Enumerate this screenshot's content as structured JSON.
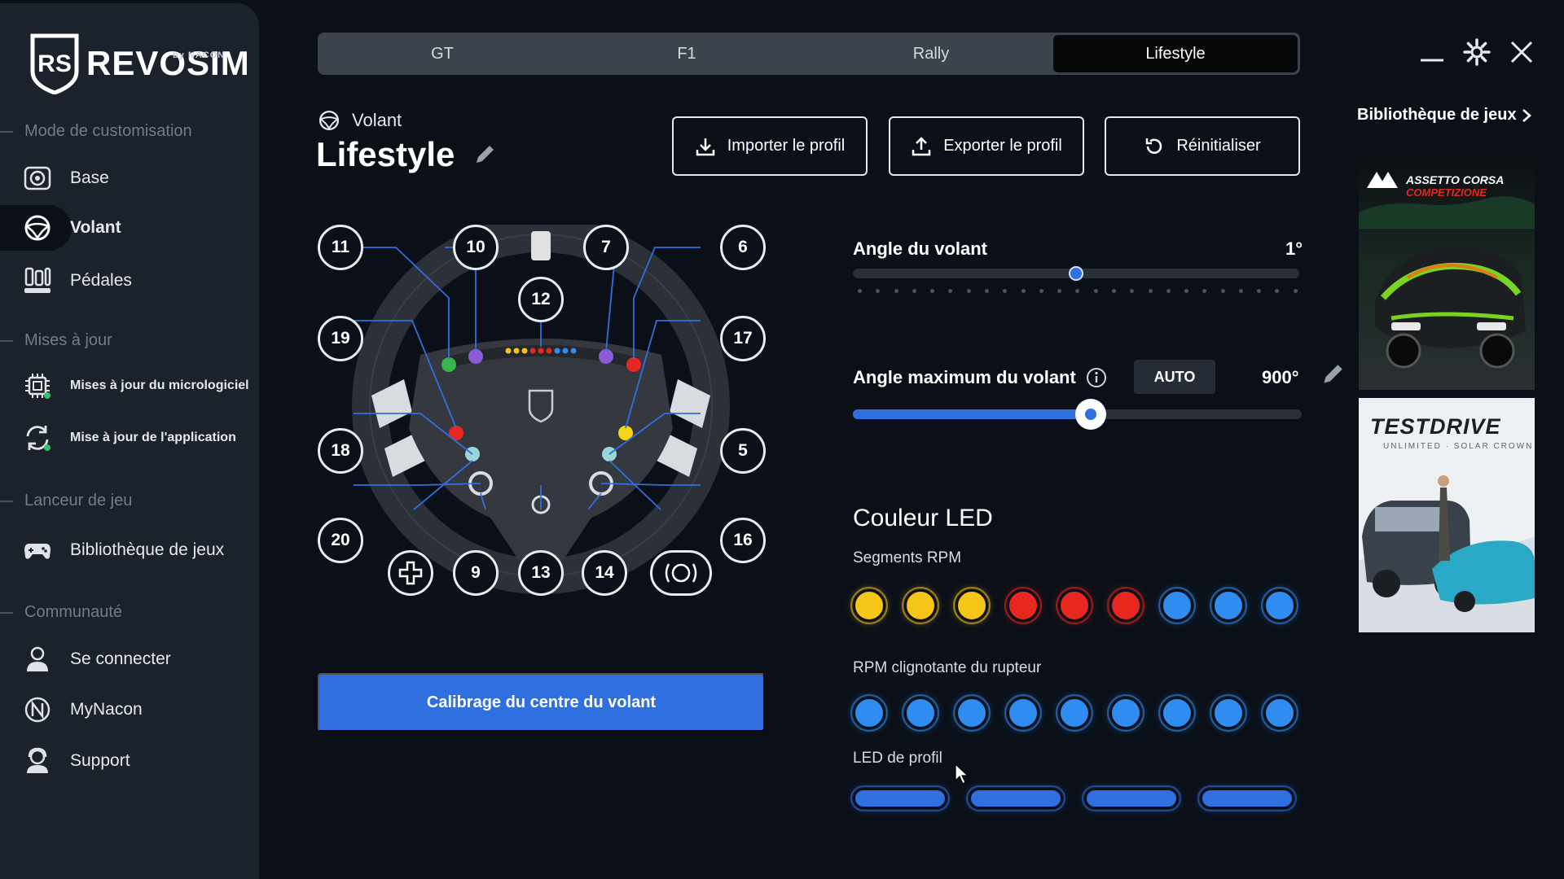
{
  "app": {
    "brand": "REVOSIM",
    "brand_sub": "by NACON"
  },
  "sidebar": {
    "sections": [
      {
        "title": "Mode de customisation"
      },
      {
        "title": "Mises à jour"
      },
      {
        "title": "Lanceur de jeu"
      },
      {
        "title": "Communauté"
      }
    ],
    "items": [
      {
        "label": "Base",
        "icon": "wheel-base-icon"
      },
      {
        "label": "Volant",
        "icon": "steering-wheel-icon",
        "active": true
      },
      {
        "label": "Pédales",
        "icon": "pedals-icon"
      },
      {
        "label": "Mises à jour du micrologiciel",
        "icon": "chip-icon"
      },
      {
        "label": "Mise à jour de l'application",
        "icon": "refresh-icon"
      },
      {
        "label": "Bibliothèque de jeux",
        "icon": "gamepad-icon"
      },
      {
        "label": "Se connecter",
        "icon": "user-icon"
      },
      {
        "label": "MyNacon",
        "icon": "nacon-icon"
      },
      {
        "label": "Support",
        "icon": "support-icon"
      }
    ]
  },
  "tabs": [
    {
      "label": "GT"
    },
    {
      "label": "F1"
    },
    {
      "label": "Rally"
    },
    {
      "label": "Lifestyle",
      "active": true
    }
  ],
  "header": {
    "mode": "Volant",
    "profile_name": "Lifestyle",
    "import_label": "Importer le profil",
    "export_label": "Exporter le profil",
    "reset_label": "Réinitialiser"
  },
  "wheel": {
    "buttons": [
      "11",
      "10",
      "7",
      "6",
      "12",
      "19",
      "17",
      "18",
      "5",
      "20",
      "9",
      "13",
      "14",
      "16"
    ],
    "calibrate_label": "Calibrage du centre du volant"
  },
  "settings": {
    "angle_label": "Angle du volant",
    "angle_value": "1°",
    "angle_fraction": 0.5,
    "max_angle_label": "Angle maximum du volant",
    "auto_label": "AUTO",
    "max_angle_value": "900°",
    "max_angle_fraction": 0.53
  },
  "led": {
    "title": "Couleur LED",
    "rpm_label": "Segments RPM",
    "rpm_colors": [
      "#f5c518",
      "#f5c518",
      "#f5c518",
      "#e8281e",
      "#e8281e",
      "#e8281e",
      "#2f8cf0",
      "#2f8cf0",
      "#2f8cf0"
    ],
    "flash_label": "RPM clignotante du rupteur",
    "flash_colors": [
      "#2f8cf0",
      "#2f8cf0",
      "#2f8cf0",
      "#2f8cf0",
      "#2f8cf0",
      "#2f8cf0",
      "#2f8cf0",
      "#2f8cf0",
      "#2f8cf0"
    ],
    "profile_label": "LED de profil",
    "profile_colors": [
      "#2f6fe0",
      "#2f6fe0",
      "#2f6fe0",
      "#2f6fe0"
    ]
  },
  "library": {
    "link_label": "Bibliothèque de jeux",
    "games": [
      {
        "title": "ASSETTO CORSA",
        "subtitle": "COMPETIZIONE"
      },
      {
        "title": "TESTDRIVE",
        "subtitle": "UNLIMITED · SOLAR CROWN"
      }
    ]
  },
  "colors": {
    "accent": "#2f6fe0",
    "background": "#0b1018",
    "sidebar": "#1c222c"
  }
}
